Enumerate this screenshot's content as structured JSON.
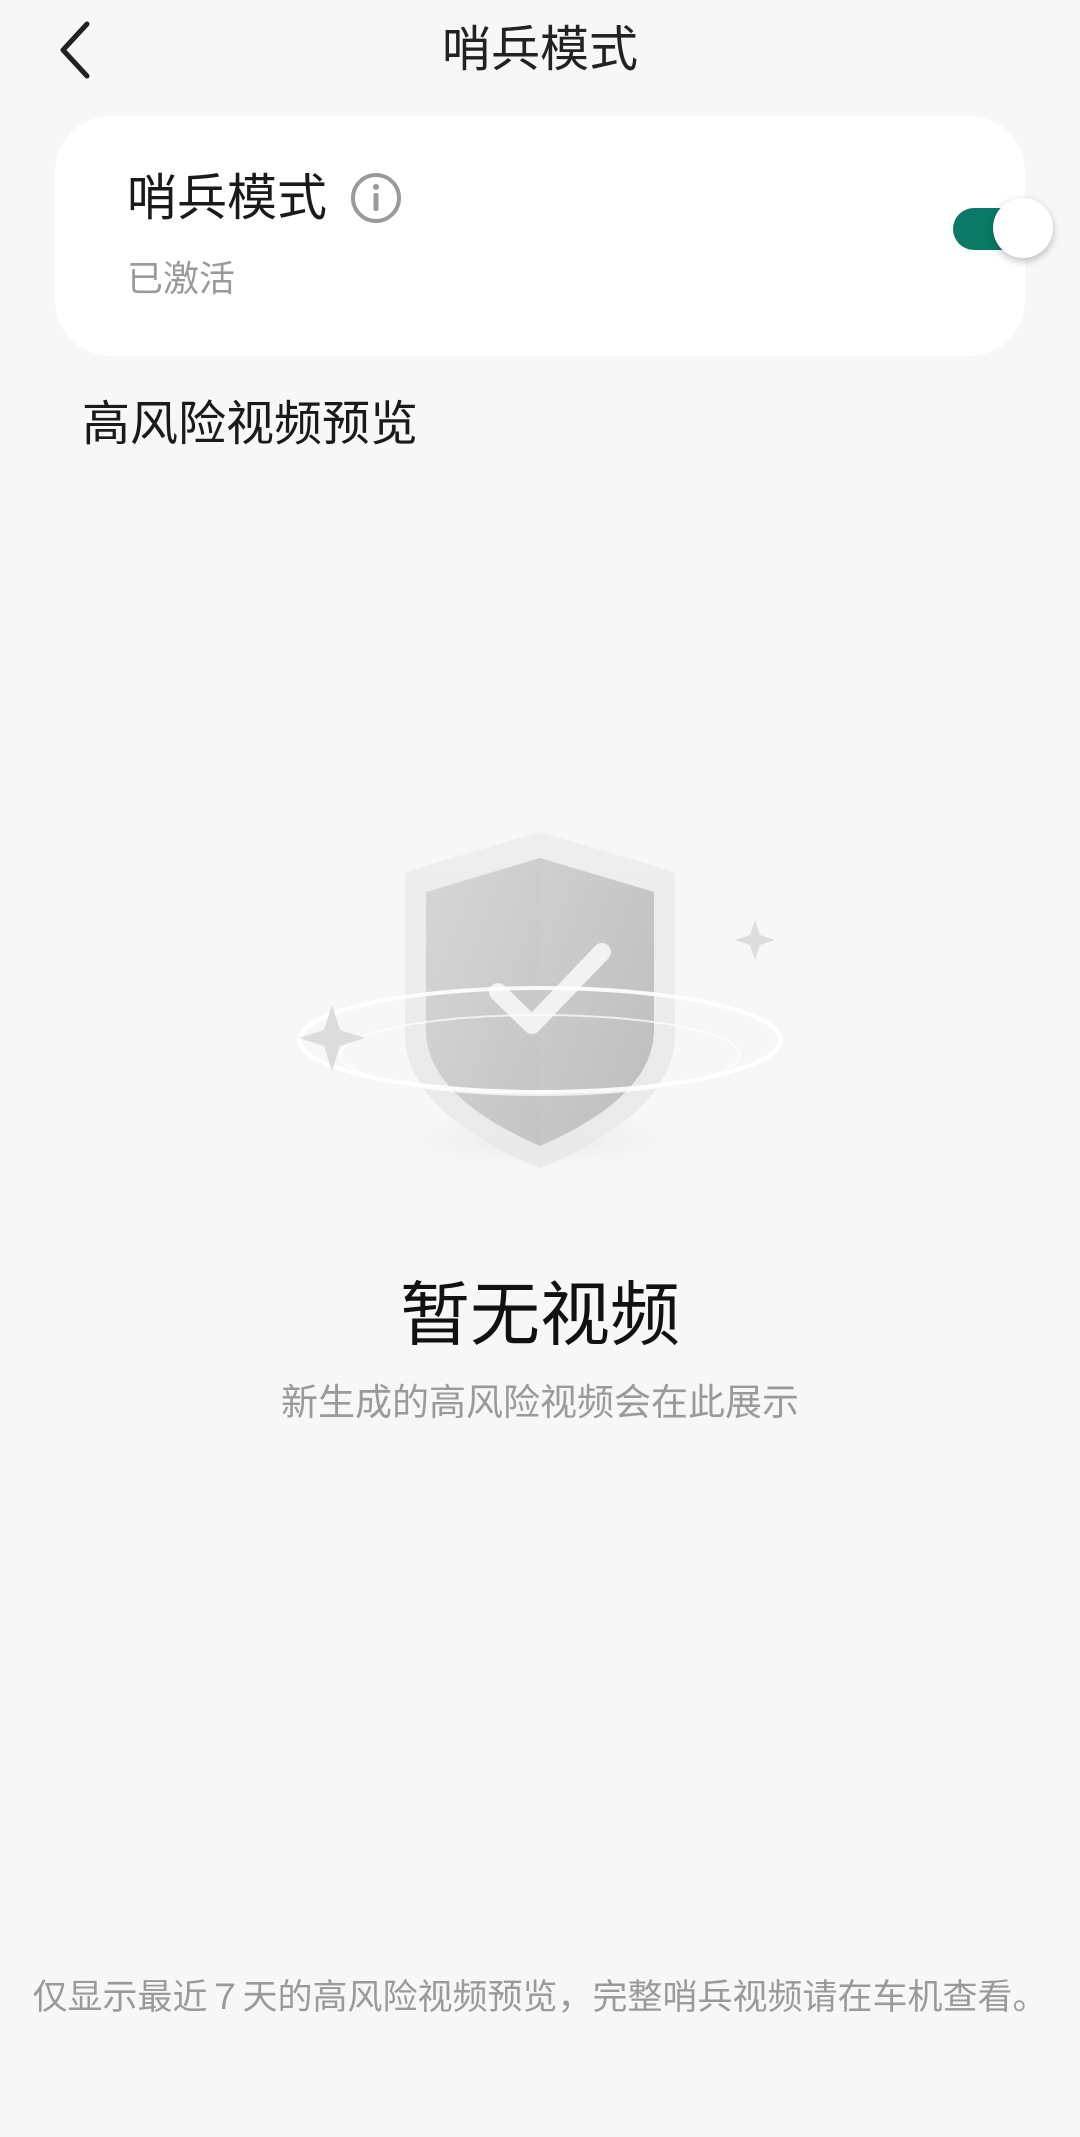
{
  "header": {
    "title": "哨兵模式",
    "back_icon": "chevron-left-icon"
  },
  "sentry_card": {
    "title": "哨兵模式",
    "status": "已激活",
    "info_icon": "info-icon",
    "toggle_on": true,
    "accent_color": "#0a7a66"
  },
  "section": {
    "title": "高风险视频预览"
  },
  "empty_state": {
    "illustration_icon": "shield-check-icon",
    "title": "暂无视频",
    "subtitle": "新生成的高风险视频会在此展示"
  },
  "footer": {
    "note": "仅显示最近７天的高风险视频预览，完整哨兵视频请在车机查看。"
  }
}
